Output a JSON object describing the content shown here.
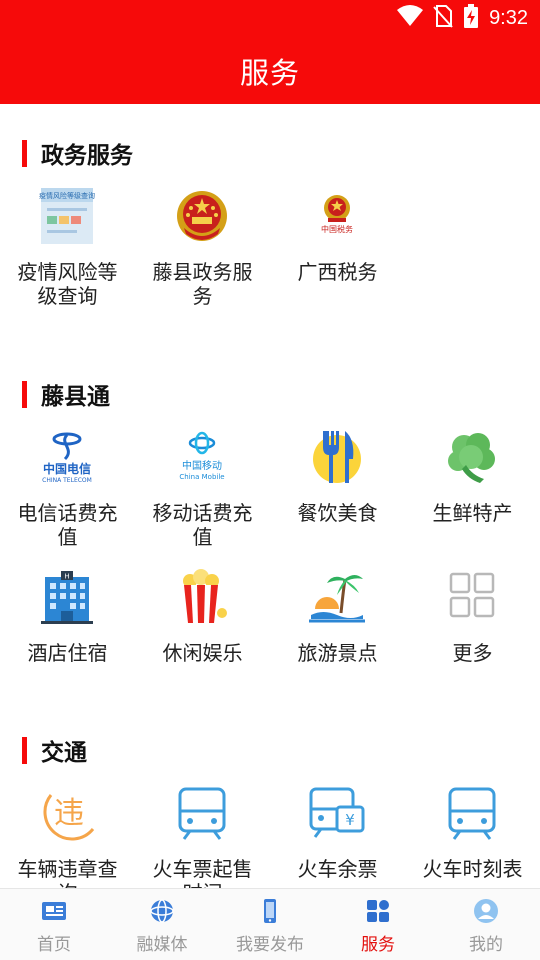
{
  "status": {
    "time": "9:32",
    "icons": [
      "wifi-icon",
      "no-sim-icon",
      "battery-charging-icon"
    ]
  },
  "header": {
    "title": "服务"
  },
  "sections": {
    "gov": {
      "title": "政务服务",
      "items": [
        {
          "label": "疫情风险等级查询",
          "icon": "epidemic-risk-query-icon"
        },
        {
          "label": "藤县政务服务",
          "icon": "national-emblem-icon"
        },
        {
          "label": "广西税务",
          "icon": "tax-emblem-icon"
        }
      ]
    },
    "tengxian": {
      "title": "藤县通",
      "items": [
        {
          "label": "电信话费充值",
          "icon": "china-telecom-icon"
        },
        {
          "label": "移动话费充值",
          "icon": "china-mobile-icon"
        },
        {
          "label": "餐饮美食",
          "icon": "fork-knife-icon"
        },
        {
          "label": "生鲜特产",
          "icon": "broccoli-icon"
        },
        {
          "label": "酒店住宿",
          "icon": "hotel-icon"
        },
        {
          "label": "休闲娱乐",
          "icon": "popcorn-icon"
        },
        {
          "label": "旅游景点",
          "icon": "island-icon"
        },
        {
          "label": "更多",
          "icon": "more-grid-icon"
        }
      ]
    },
    "traffic": {
      "title": "交通",
      "items": [
        {
          "label": "车辆违章查询",
          "icon": "traffic-violation-icon"
        },
        {
          "label": "火车票起售时间",
          "icon": "train-icon"
        },
        {
          "label": "火车余票",
          "icon": "train-ticket-icon"
        },
        {
          "label": "火车时刻表",
          "icon": "train-icon"
        }
      ]
    }
  },
  "logo_text": {
    "telecom_cn": "中国电信",
    "telecom_en": "CHINA TELECOM",
    "mobile_cn": "中国移动",
    "mobile_en": "China Mobile",
    "epidemic_banner": "疫情风险等级查询",
    "tax_seal": "中国税务",
    "violation_glyph": "违",
    "ticket_glyph": "¥",
    "hotel_sign": "H"
  },
  "tabbar": {
    "items": [
      {
        "label": "首页",
        "icon": "news-icon",
        "active": false
      },
      {
        "label": "融媒体",
        "icon": "globe-icon",
        "active": false
      },
      {
        "label": "我要发布",
        "icon": "phone-icon",
        "active": false
      },
      {
        "label": "服务",
        "icon": "grid-icon",
        "active": true
      },
      {
        "label": "我的",
        "icon": "user-icon",
        "active": false
      }
    ]
  },
  "colors": {
    "brand_red": "#f60a0a",
    "active_tab": "#e3100e",
    "inactive_tab": "#999999",
    "icon_blue": "#3d9ddc"
  }
}
